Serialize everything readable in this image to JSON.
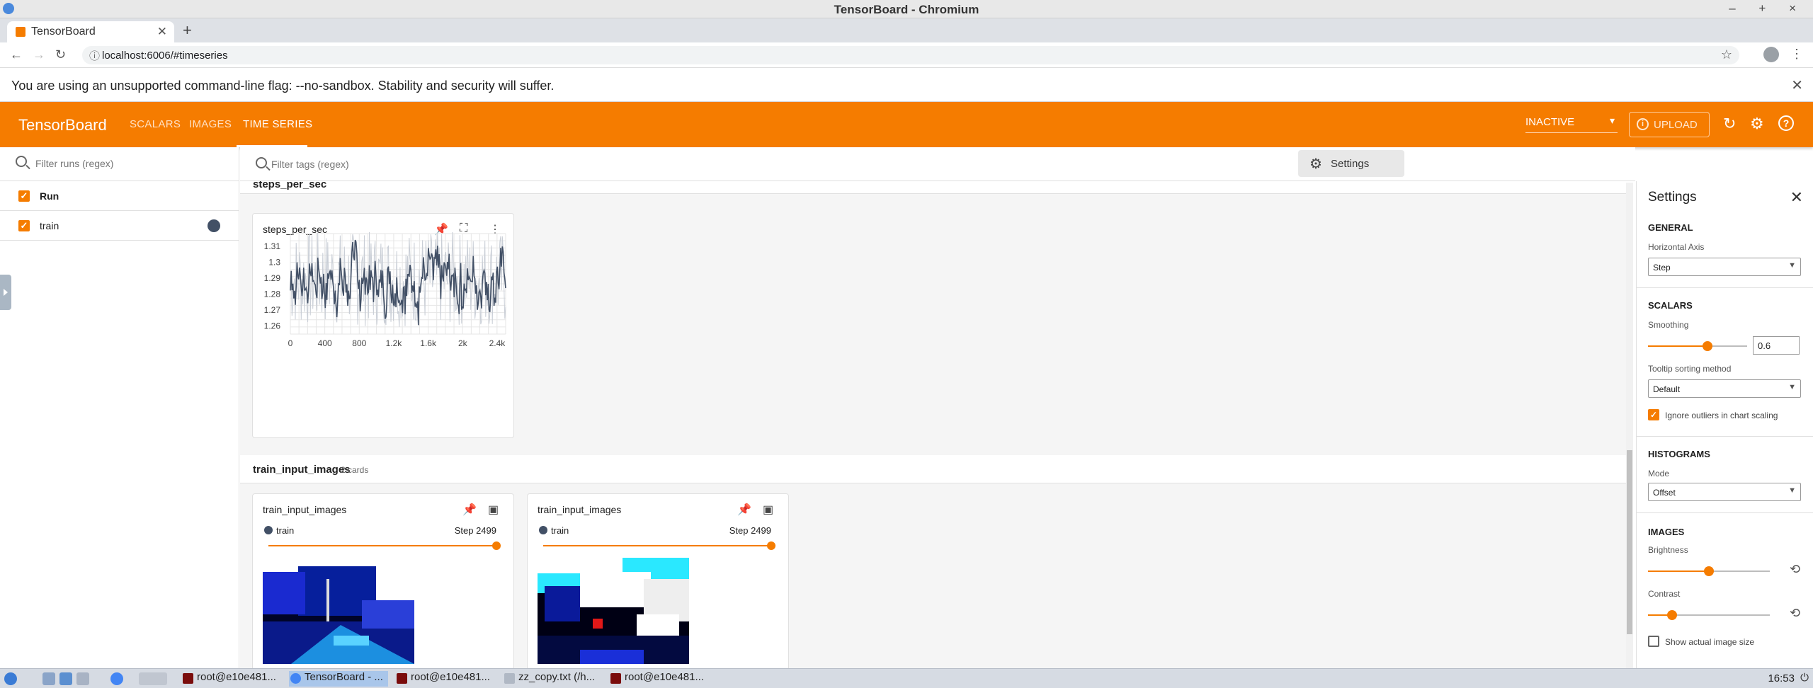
{
  "window": {
    "title": "TensorBoard - Chromium"
  },
  "browser": {
    "tab_title": "TensorBoard",
    "url": "localhost:6006/#timeseries",
    "infobar_message": "You are using an unsupported command-line flag: --no-sandbox. Stability and security will suffer."
  },
  "header": {
    "brand": "TensorBoard",
    "tabs": [
      "SCALARS",
      "IMAGES",
      "TIME SERIES"
    ],
    "active_tab": "TIME SERIES",
    "refresh_state": "INACTIVE",
    "upload_label": "UPLOAD",
    "accent": "#f57c00"
  },
  "runs_panel": {
    "filter_placeholder": "Filter runs (regex)",
    "header_label": "Run",
    "runs": [
      {
        "name": "train",
        "color": "#425066"
      }
    ]
  },
  "main": {
    "tag_filter_placeholder": "Filter tags (regex)",
    "settings_button": "Settings",
    "groups": [
      {
        "name": "steps_per_sec",
        "cards": [
          {
            "title": "steps_per_sec",
            "chart_data": {
              "type": "line",
              "x_ticks": [
                "0",
                "400",
                "800",
                "1.2k",
                "1.6k",
                "2k",
                "2.4k"
              ],
              "y_ticks": [
                "1.26",
                "1.27",
                "1.28",
                "1.29",
                "1.3",
                "1.31"
              ],
              "xlim": [
                0,
                2499
              ],
              "ylim": [
                1.255,
                1.318
              ],
              "series": [
                {
                  "name": "train",
                  "color": "#425066"
                }
              ]
            }
          }
        ]
      },
      {
        "name": "train_input_images",
        "count_label": "2 cards",
        "cards": [
          {
            "title": "train_input_images",
            "run": "train",
            "step": "Step 2499"
          },
          {
            "title": "train_input_images",
            "run": "train",
            "step": "Step 2499"
          }
        ]
      }
    ]
  },
  "settings": {
    "title": "Settings",
    "general": "GENERAL",
    "horizontal_axis_label": "Horizontal Axis",
    "horizontal_axis_value": "Step",
    "scalars": "SCALARS",
    "smoothing_label": "Smoothing",
    "smoothing_value": "0.6",
    "tooltip_label": "Tooltip sorting method",
    "tooltip_value": "Default",
    "ignore_outliers_label": "Ignore outliers in chart scaling",
    "histograms": "HISTOGRAMS",
    "mode_label": "Mode",
    "mode_value": "Offset",
    "images": "IMAGES",
    "brightness_label": "Brightness",
    "contrast_label": "Contrast",
    "show_actual_label": "Show actual image size"
  },
  "taskbar": {
    "items": [
      "root@e10e481...",
      "TensorBoard - ...",
      "root@e10e481...",
      "zz_copy.txt (/h...",
      "root@e10e481..."
    ],
    "clock": "16:53"
  }
}
